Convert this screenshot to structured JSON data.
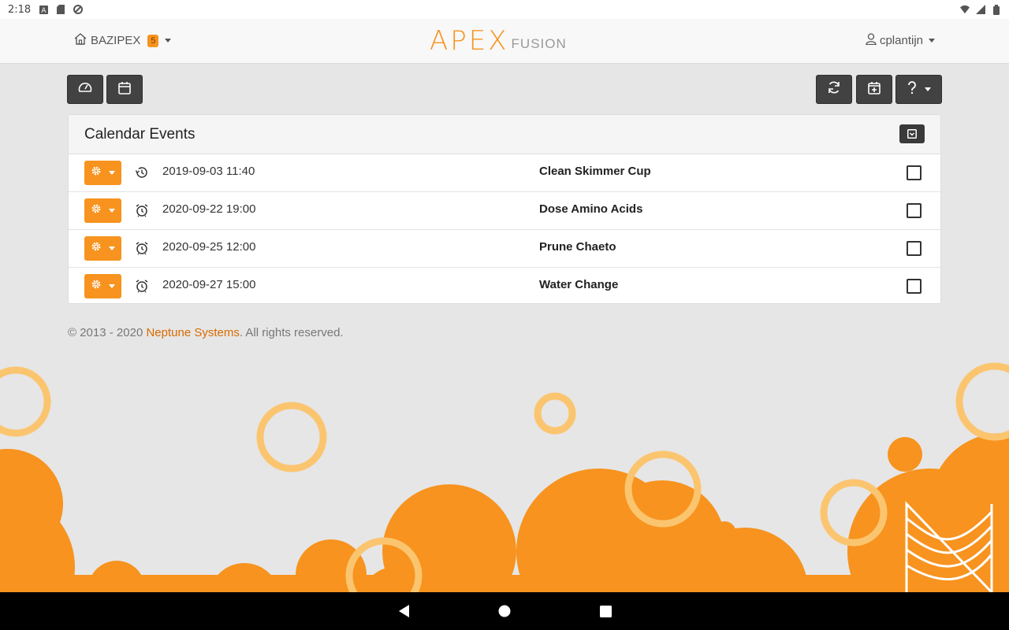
{
  "status_bar": {
    "time": "2:18",
    "icons": [
      "a-notification-icon",
      "sd-card-icon",
      "sync-icon",
      "wifi-icon",
      "signal-icon",
      "battery-icon"
    ]
  },
  "navbar": {
    "home_label": "BAZIPEX",
    "badge": "5",
    "logo_main": "APEX",
    "logo_sub": "FUSION",
    "user_label": "cplantijn"
  },
  "toolbar": {
    "left_buttons": [
      "dashboard-icon",
      "calendar-icon"
    ],
    "right_buttons": [
      "refresh-icon",
      "calendar-add-icon",
      "help-icon"
    ]
  },
  "panel": {
    "title": "Calendar Events",
    "events": [
      {
        "icon": "history-icon",
        "datetime": "2019-09-03 11:40",
        "title": "Clean Skimmer Cup"
      },
      {
        "icon": "alarm-icon",
        "datetime": "2020-09-22 19:00",
        "title": "Dose Amino Acids"
      },
      {
        "icon": "alarm-icon",
        "datetime": "2020-09-25 12:00",
        "title": "Prune Chaeto"
      },
      {
        "icon": "alarm-icon",
        "datetime": "2020-09-27 15:00",
        "title": "Water Change"
      }
    ]
  },
  "footer": {
    "prefix": "© 2013 - 2020 ",
    "link": "Neptune Systems",
    "suffix": ". All rights reserved."
  },
  "colors": {
    "accent": "#f7931e",
    "dark_button": "#424242",
    "background": "#e6e6e6",
    "link": "#d96a00"
  }
}
